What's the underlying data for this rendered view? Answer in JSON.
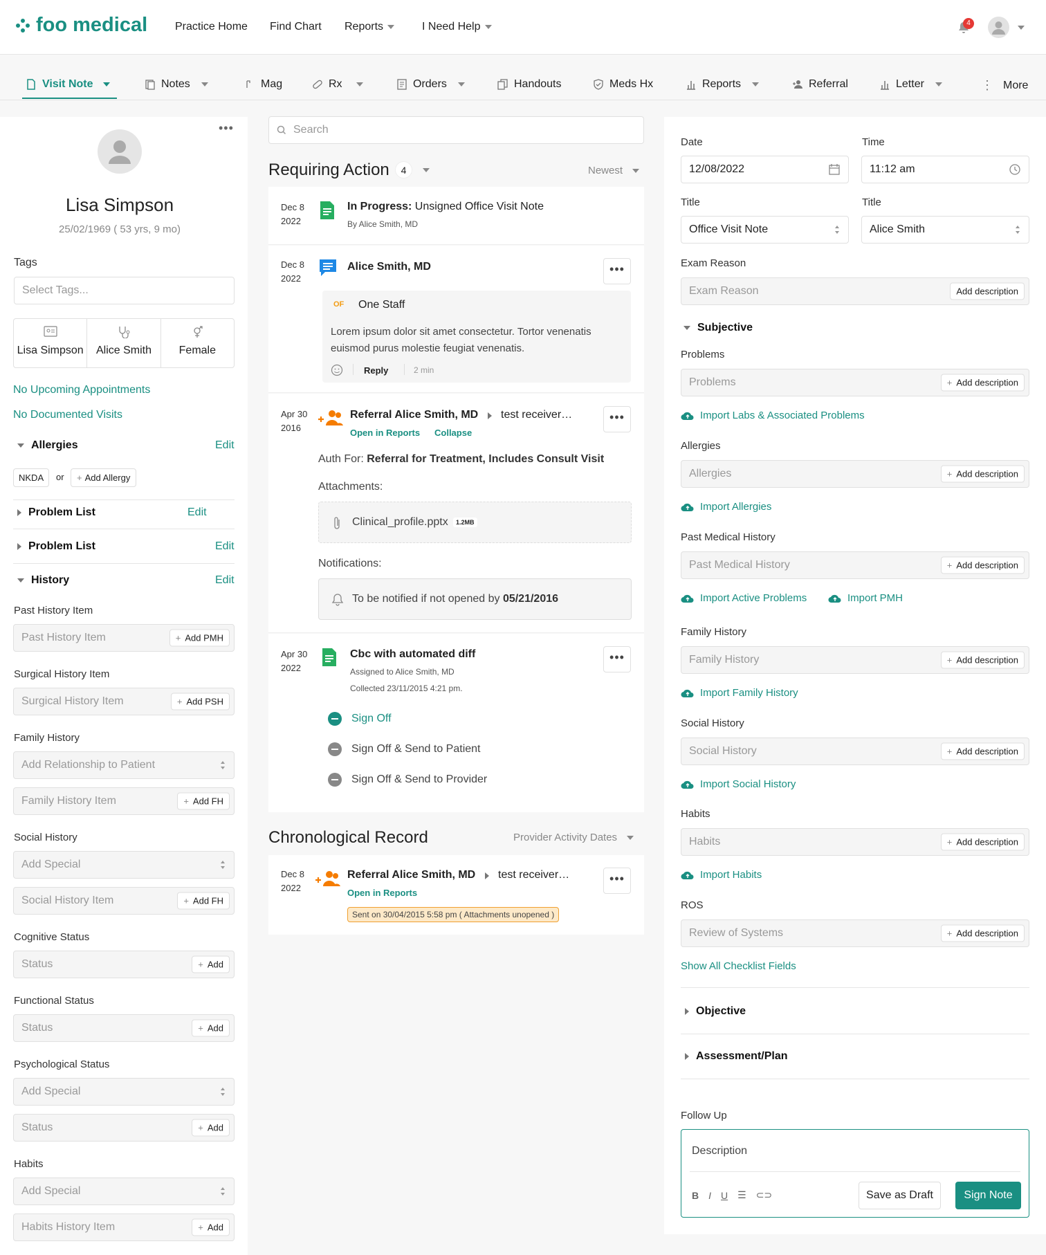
{
  "brand": {
    "name": "foo medical",
    "accent": "#1a8f82"
  },
  "topnav": {
    "items": [
      "Practice Home",
      "Find Chart",
      "Reports",
      "I Need Help"
    ],
    "notif_count": "4"
  },
  "toolbar": {
    "items": [
      "Visit Note",
      "Notes",
      "Mag",
      "Rx",
      "Orders",
      "Handouts",
      "Meds Hx",
      "Reports",
      "Referral",
      "Letter",
      "More"
    ]
  },
  "patient": {
    "name": "Lisa Simpson",
    "dob": "25/02/1969 ( 53 yrs, 9 mo)",
    "tags_label": "Tags",
    "tags_placeholder": "Select Tags...",
    "info": [
      "Lisa Simpson",
      "Alice Smith",
      "Female"
    ],
    "no_appts": "No Upcoming Appointments",
    "no_visits": "No Documented Visits",
    "allergies": "Allergies",
    "edit": "Edit",
    "nkda": "NKDA",
    "or": "or",
    "add_allergy": "Add Allergy",
    "problem_list": "Problem List",
    "history": "History",
    "fields": {
      "past_history": "Past History Item",
      "past_placeholder": "Past History Item",
      "add_pmh": "Add PMH",
      "surgical": "Surgical History Item",
      "surgical_placeholder": "Surgical History Item",
      "add_psh": "Add PSH",
      "family": "Family History",
      "family_rel": "Add Relationship to Patient",
      "family_item": "Family History Item",
      "add_fh": "Add FH",
      "social": "Social History",
      "add_special": "Add Special",
      "social_item": "Social History Item",
      "cognitive": "Cognitive Status",
      "status": "Status",
      "add": "Add",
      "functional": "Functional Status",
      "psych": "Psychological Status",
      "habits": "Habits",
      "habits_item": "Habits History Item"
    }
  },
  "feed": {
    "search": "Search",
    "title": "Requiring Action",
    "count": "4",
    "sort": "Newest",
    "items": [
      {
        "month": "Dec 8",
        "year": "2022",
        "title_bold": "In Progress:",
        "title": " Unsigned Office Visit Note",
        "sub": "By Alice Smith, MD"
      },
      {
        "month": "Dec 8",
        "year": "2022",
        "title": "Alice Smith, MD",
        "initials": "OF",
        "staff": "One Staff",
        "body": "Lorem ipsum dolor sit amet consectetur. Tortor venenatis euismod purus molestie feugiat venenatis.",
        "reply": "Reply",
        "time": "2 min"
      },
      {
        "month": "Apr 30",
        "year": "2016",
        "title": "Referral Alice Smith, MD",
        "to": "test receiver…",
        "open": "Open in Reports",
        "collapse": "Collapse",
        "auth_prefix": "Auth For: ",
        "auth": "Referral for Treatment, Includes Consult Visit",
        "attachments": "Attachments:",
        "file": "Clinical_profile.pptx",
        "size": "1.2MB",
        "notifications": "Notifications:",
        "notify_prefix": "To be notified if not opened by ",
        "notify_date": "05/21/2016"
      },
      {
        "month": "Apr 30",
        "year": "2022",
        "title": "Cbc with automated diff",
        "assigned": "Assigned to Alice Smith, MD",
        "collected": "Collected 23/11/2015 4:21 pm.",
        "actions": [
          "Sign Off",
          "Sign Off & Send to Patient",
          "Sign Off & Send to Provider"
        ]
      }
    ],
    "chrono_title": "Chronological Record",
    "chrono_sort": "Provider Activity Dates",
    "chrono": {
      "month": "Dec 8",
      "year": "2022",
      "title": "Referral Alice Smith, MD",
      "to": "test receiver…",
      "open": "Open in Reports",
      "sent": "Sent on 30/04/2015 5:58 pm ( Attachments unopened )"
    }
  },
  "note": {
    "date_label": "Date",
    "date": "12/08/2022",
    "time_label": "Time",
    "time": "11:12 am",
    "title_label": "Title",
    "title_val": "Office Visit Note",
    "title2_label": "Title",
    "title2_val": "Alice Smith",
    "exam_label": "Exam Reason",
    "exam_ph": "Exam Reason",
    "add_desc": "Add description",
    "subjective": "Subjective",
    "problems": "Problems",
    "import_labs": "Import Labs & Associated Problems",
    "allergies": "Allergies",
    "import_allergies": "Import Allergies",
    "pmh": "Past Medical History",
    "import_active": "Import Active Problems",
    "import_pmh": "Import PMH",
    "family": "Family History",
    "import_family": "Import Family History",
    "social": "Social History",
    "import_social": "Import Social History",
    "habits": "Habits",
    "import_habits": "Import Habits",
    "ros": "ROS",
    "ros_ph": "Review of Systems",
    "show_all": "Show All Checklist Fields",
    "objective": "Objective",
    "assessment": "Assessment/Plan",
    "follow_up": "Follow Up",
    "description": "Description",
    "save_draft": "Save as Draft",
    "sign": "Sign Note"
  }
}
